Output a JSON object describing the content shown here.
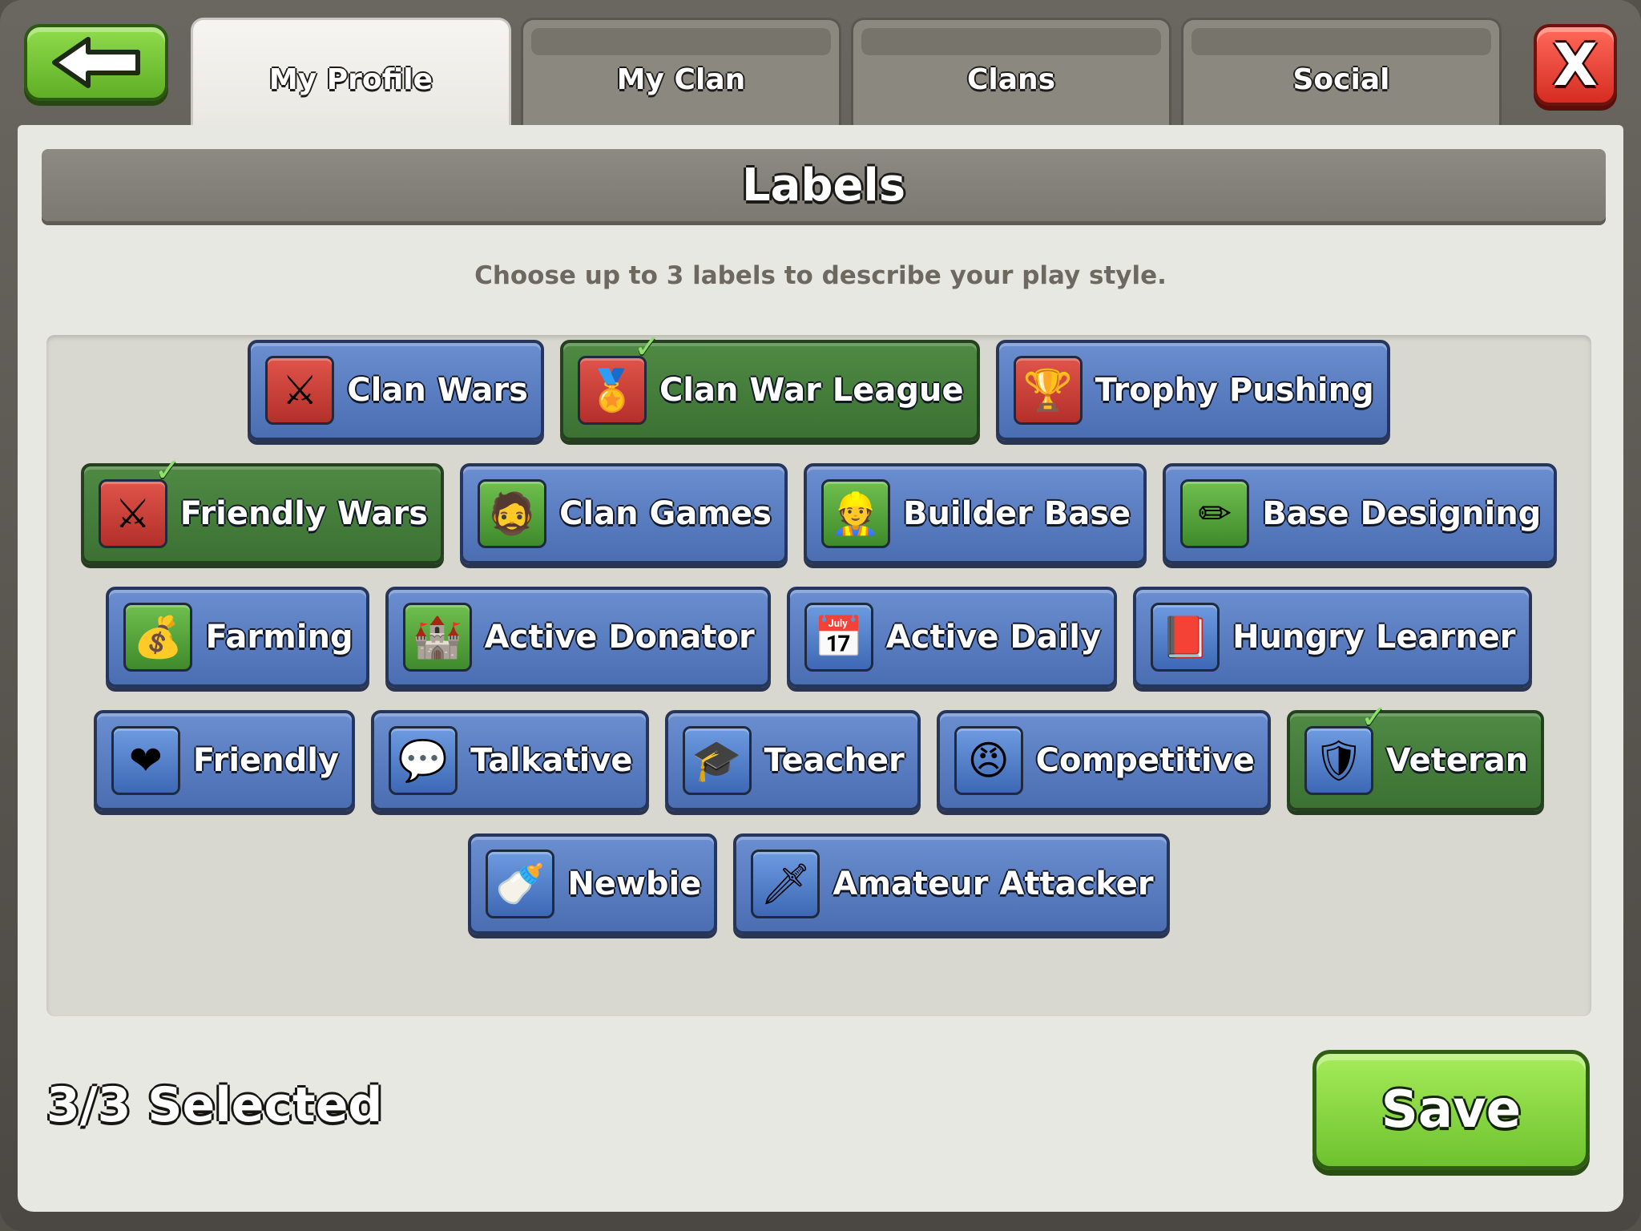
{
  "tabs": [
    {
      "label": "My Profile",
      "active": true
    },
    {
      "label": "My Clan",
      "active": false
    },
    {
      "label": "Clans",
      "active": false
    },
    {
      "label": "Social",
      "active": false
    }
  ],
  "close_label": "X",
  "header": {
    "title": "Labels"
  },
  "instructions": "Choose up to 3 labels to describe your play style.",
  "rows": [
    [
      {
        "label": "Clan Wars",
        "icon": "crossed-swords-shield-icon",
        "glyph": "⚔",
        "icon_bg": "red",
        "selected": false
      },
      {
        "label": "Clan War League",
        "icon": "gold-league-badge-icon",
        "glyph": "🏅",
        "icon_bg": "red",
        "selected": true
      },
      {
        "label": "Trophy Pushing",
        "icon": "trophy-icon",
        "glyph": "🏆",
        "icon_bg": "red",
        "selected": false
      }
    ],
    [
      {
        "label": "Friendly Wars",
        "icon": "crossed-swords-icon",
        "glyph": "⚔",
        "icon_bg": "red",
        "selected": true
      },
      {
        "label": "Clan Games",
        "icon": "barbarian-face-icon",
        "glyph": "🧔",
        "icon_bg": "green",
        "selected": false
      },
      {
        "label": "Builder Base",
        "icon": "builder-face-icon",
        "glyph": "👷",
        "icon_bg": "green",
        "selected": false
      },
      {
        "label": "Base Designing",
        "icon": "blueprint-pencil-icon",
        "glyph": "✏",
        "icon_bg": "green",
        "selected": false
      }
    ],
    [
      {
        "label": "Farming",
        "icon": "gold-elixir-icon",
        "glyph": "💰",
        "icon_bg": "green",
        "selected": false
      },
      {
        "label": "Active Donator",
        "icon": "clan-castle-icon",
        "glyph": "🏰",
        "icon_bg": "green",
        "selected": false
      },
      {
        "label": "Active Daily",
        "icon": "calendar-icon",
        "glyph": "📅",
        "icon_bg": "blue",
        "selected": false
      },
      {
        "label": "Hungry Learner",
        "icon": "book-icon",
        "glyph": "📕",
        "icon_bg": "blue",
        "selected": false
      }
    ],
    [
      {
        "label": "Friendly",
        "icon": "heart-icon",
        "glyph": "❤",
        "icon_bg": "blue",
        "selected": false
      },
      {
        "label": "Talkative",
        "icon": "speech-bubble-icon",
        "glyph": "💬",
        "icon_bg": "blue",
        "selected": false
      },
      {
        "label": "Teacher",
        "icon": "graduation-cap-icon",
        "glyph": "🎓",
        "icon_bg": "blue",
        "selected": false
      },
      {
        "label": "Competitive",
        "icon": "angry-face-icon",
        "glyph": "😠",
        "icon_bg": "blue",
        "selected": false
      },
      {
        "label": "Veteran",
        "icon": "veteran-helmet-icon",
        "glyph": "🛡",
        "icon_bg": "blue",
        "selected": true
      }
    ],
    [
      {
        "label": "Newbie",
        "icon": "pacifier-icon",
        "glyph": "🍼",
        "icon_bg": "blue",
        "selected": false
      },
      {
        "label": "Amateur Attacker",
        "icon": "sword-icon",
        "glyph": "🗡",
        "icon_bg": "blue",
        "selected": false
      }
    ]
  ],
  "footer": {
    "selected_count": "3/3 Selected",
    "save_label": "Save"
  },
  "colors": {
    "selected_bg": "#3f7536",
    "unselected_bg": "#5478bf",
    "save_green": "#7ccd35",
    "close_red": "#e0372b"
  }
}
